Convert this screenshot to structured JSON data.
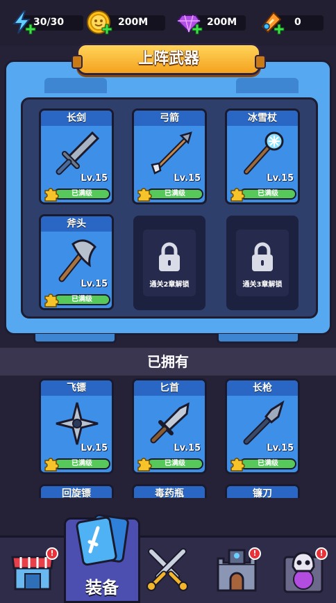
{
  "resources": [
    {
      "name": "energy",
      "icon": "lightning-icon",
      "value": "30/30"
    },
    {
      "name": "coins",
      "icon": "coin-icon",
      "value": "200M"
    },
    {
      "name": "gems",
      "icon": "gem-icon",
      "value": "200M"
    },
    {
      "name": "tickets",
      "icon": "ticket-icon",
      "value": "0"
    }
  ],
  "equipped": {
    "title": "上阵武器",
    "weapons": [
      {
        "name": "长剑",
        "level": "Lv.15",
        "status": "已满级",
        "icon": "sword-icon"
      },
      {
        "name": "弓箭",
        "level": "Lv.15",
        "status": "已满级",
        "icon": "arrow-icon"
      },
      {
        "name": "冰雪杖",
        "level": "Lv.15",
        "status": "已满级",
        "icon": "ice-staff-icon"
      },
      {
        "name": "斧头",
        "level": "Lv.15",
        "status": "已满级",
        "icon": "axe-icon"
      }
    ],
    "locked_slots": [
      {
        "text": "通关2章解锁"
      },
      {
        "text": "通关3章解锁"
      }
    ]
  },
  "owned": {
    "title": "已拥有",
    "weapons": [
      {
        "name": "飞镖",
        "level": "Lv.15",
        "status": "已满级",
        "icon": "shuriken-icon"
      },
      {
        "name": "匕首",
        "level": "Lv.15",
        "status": "已满级",
        "icon": "dagger-icon"
      },
      {
        "name": "长枪",
        "level": "Lv.15",
        "status": "已满级",
        "icon": "spear-icon"
      },
      {
        "name": "回旋镖",
        "icon": "boomerang-icon"
      },
      {
        "name": "毒药瓶",
        "icon": "poison-bottle-icon"
      },
      {
        "name": "镰刀",
        "icon": "scythe-icon"
      }
    ]
  },
  "nav": {
    "active_label": "装备",
    "items": [
      {
        "name": "shop",
        "icon": "shop-icon",
        "badge": "!"
      },
      {
        "name": "equipment",
        "icon": "cards-icon"
      },
      {
        "name": "battle",
        "icon": "crossed-swords-icon"
      },
      {
        "name": "castle",
        "icon": "castle-icon",
        "badge": "!"
      },
      {
        "name": "skull-portal",
        "icon": "skull-portal-icon",
        "badge": "!"
      }
    ]
  }
}
